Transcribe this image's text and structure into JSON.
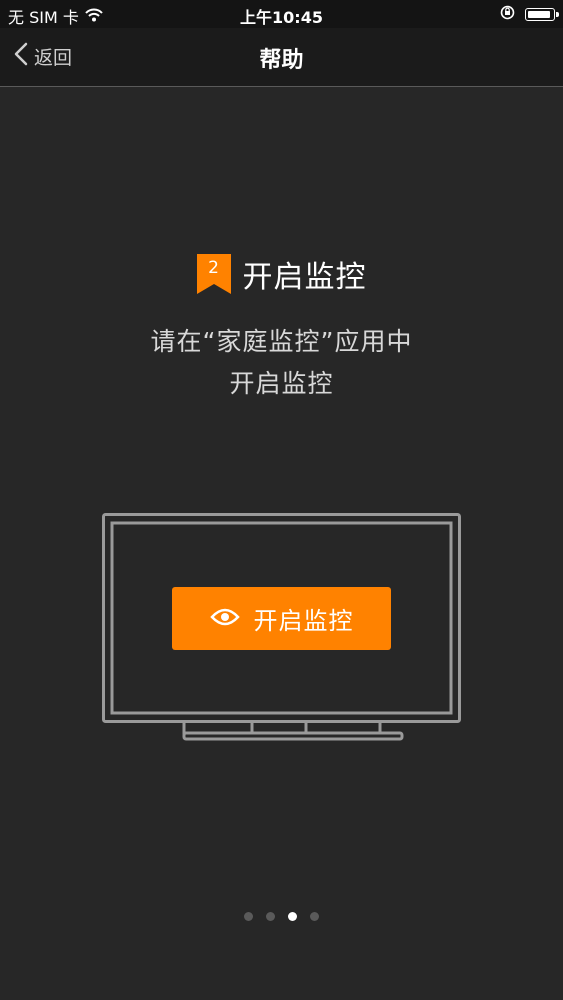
{
  "status_bar": {
    "carrier": "无 SIM 卡",
    "time": "上午10:45",
    "wifi_icon": "wifi-icon",
    "rotation_lock_icon": "rotation-lock-icon",
    "battery_level": 1.0
  },
  "nav": {
    "back_label": "返回",
    "title": "帮助"
  },
  "step": {
    "number": "2",
    "title": "开启监控",
    "badge_color": "#ff8200"
  },
  "description": {
    "line1": "请在“家庭监控”应用中",
    "line2": "开启监控"
  },
  "illustration": {
    "button_label": "开启监控",
    "button_icon": "eye-icon",
    "button_color": "#ff8200"
  },
  "pager": {
    "count": 4,
    "active_index": 2
  }
}
